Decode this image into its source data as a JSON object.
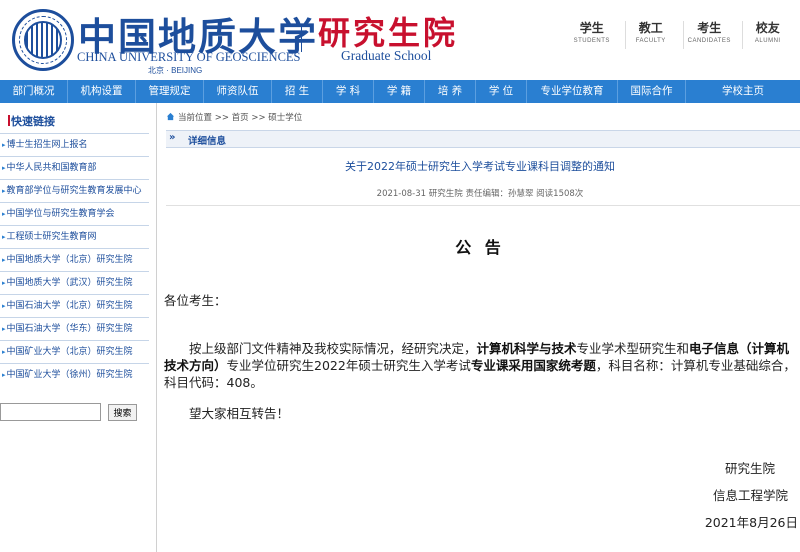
{
  "header": {
    "university_cn": "中国地质大学",
    "university_en": "CHINA UNIVERSITY OF GEOSCIENCES",
    "city": "北京 · BEIJING",
    "school_cn": "研究生院",
    "school_en": "Graduate School",
    "top_links": [
      {
        "cn": "学生",
        "en": "STUDENTS"
      },
      {
        "cn": "教工",
        "en": "FACULTY"
      },
      {
        "cn": "考生",
        "en": "CANDIDATES"
      },
      {
        "cn": "校友",
        "en": "ALUMNI"
      }
    ],
    "colors": {
      "brand_blue": "#1d4e9c",
      "brand_red": "#c8102e",
      "nav_blue": "#2a7fd1"
    }
  },
  "nav": {
    "items": [
      "部门概况",
      "机构设置",
      "管理规定",
      "师资队伍",
      "招 生",
      "学 科",
      "学 籍",
      "培 养",
      "学 位",
      "专业学位教育",
      "国际合作",
      "学校主页"
    ]
  },
  "sidebar": {
    "title": "快速链接",
    "links": [
      "博士生招生网上报名",
      "中华人民共和国教育部",
      "教育部学位与研究生教育发展中心",
      "中国学位与研究生教育学会",
      "工程硕士研究生教育网",
      "中国地质大学（北京）研究生院",
      "中国地质大学（武汉）研究生院",
      "中国石油大学（北京）研究生院",
      "中国石油大学（华东）研究生院",
      "中国矿业大学（北京）研究生院",
      "中国矿业大学（徐州）研究生院"
    ],
    "search_value": "",
    "search_button": "搜索"
  },
  "main": {
    "breadcrumb": "当前位置 >> 首页 >> 硕士学位",
    "section_label": "详细信息",
    "article_title": "关于2022年硕士研究生入学考试专业课科目调整的通知",
    "article_meta": "2021-08-31  研究生院  责任编辑：孙慧翠  阅读1508次",
    "notice_heading": "公 告",
    "salutation": "各位考生：",
    "para": {
      "p1": "按上级部门文件精神及我校实际情况，经研究决定，",
      "b1": "计算机科学与技术",
      "p2": "专业学术型研究生和",
      "b2": "电子信息（计算机技术方向）",
      "p3": "专业学位研究生2022年硕士研究生入学考试",
      "b3": "专业课采用国家统考题",
      "p4": "，科目名称：计算机专业基础综合，科目代码：408。"
    },
    "closing": "望大家相互转告！",
    "signatures": [
      "研究生院",
      "信息工程学院",
      "2021年8月26日"
    ]
  }
}
